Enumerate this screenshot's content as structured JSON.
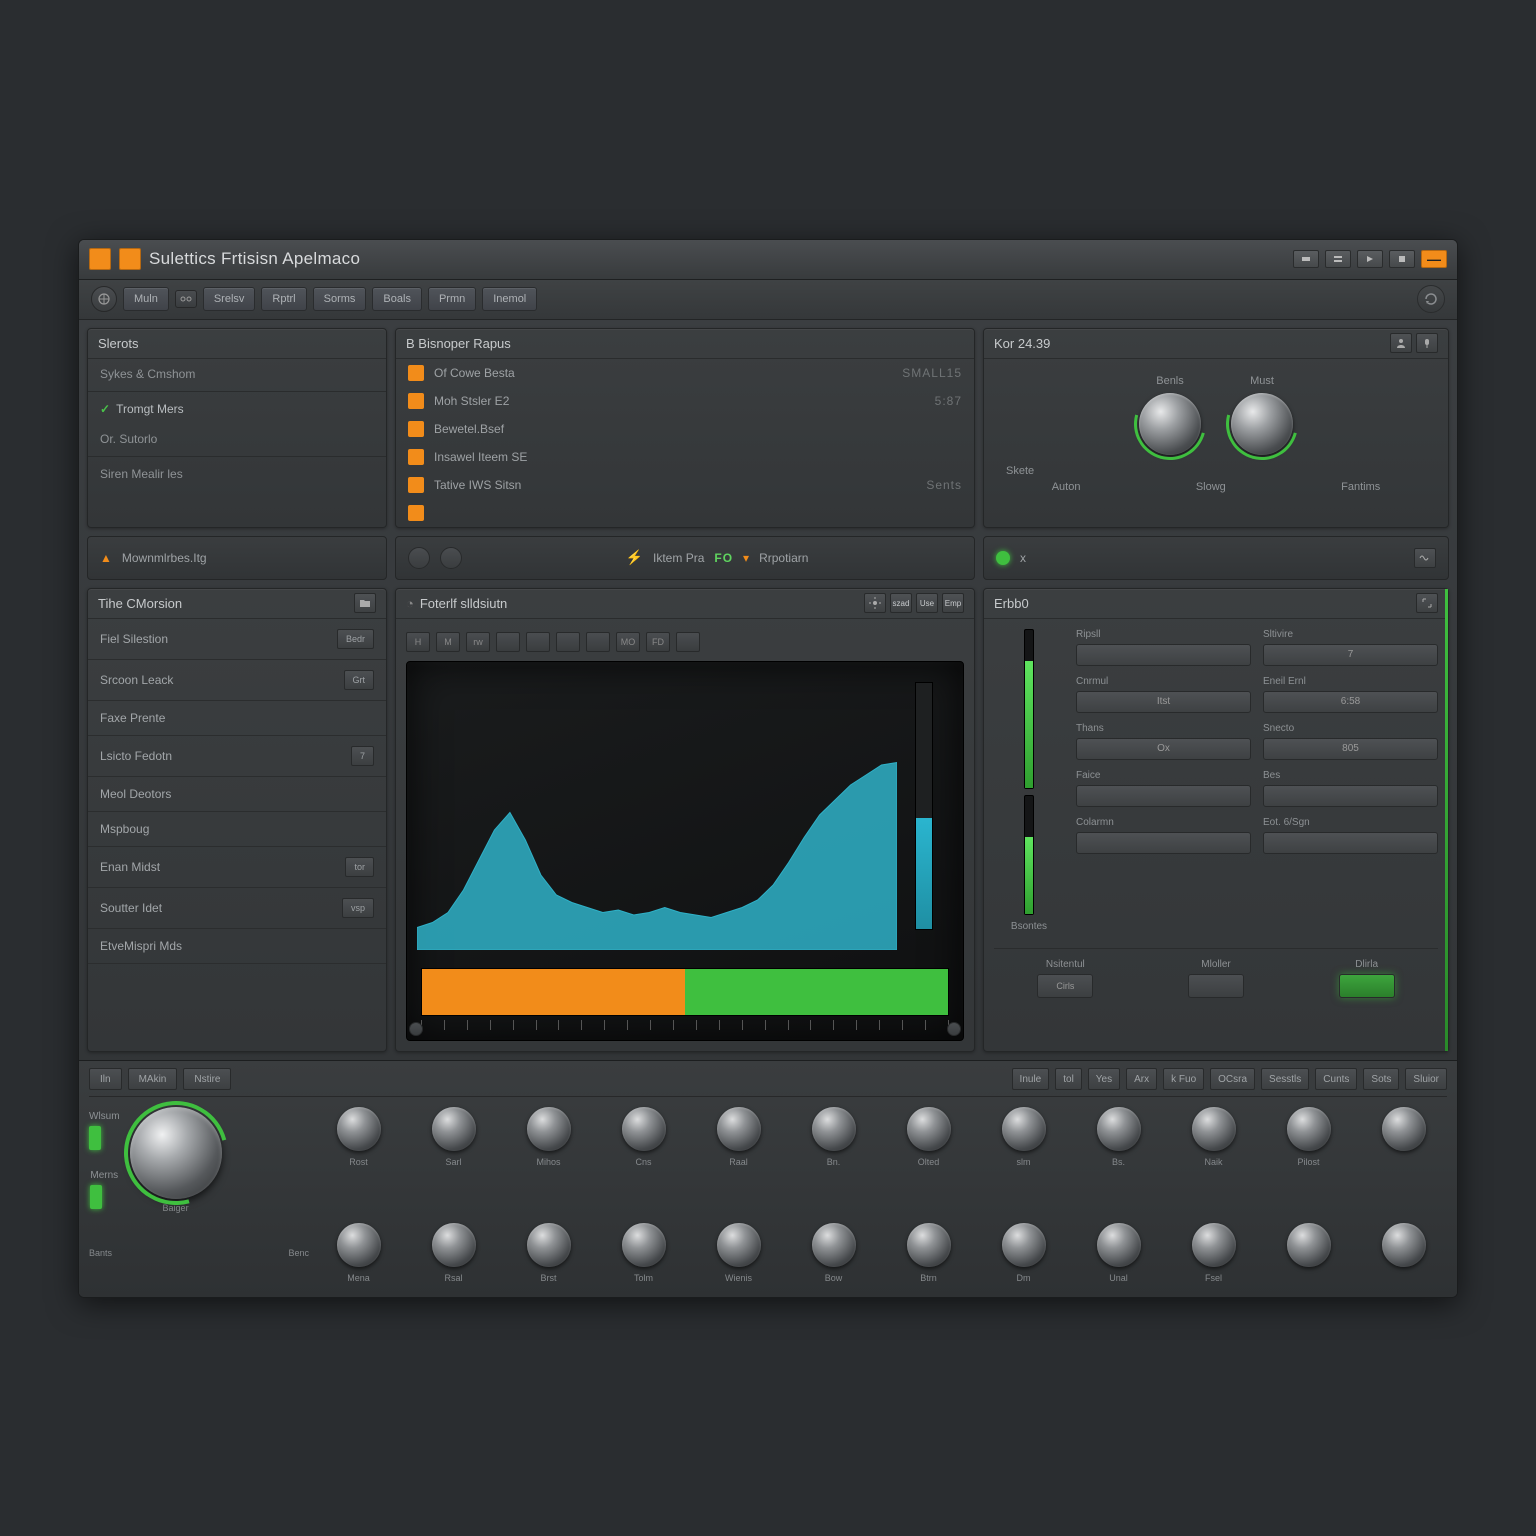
{
  "colors": {
    "accent_orange": "#f28c1a",
    "accent_green": "#3fbf3f",
    "wave_teal": "#2fb1c8"
  },
  "title": "Sulettics Frtisisn Apelmaco",
  "toolbar": {
    "buttons": [
      "Muln",
      "Srelsv",
      "Rptrl",
      "Sorms",
      "Boals",
      "Prmn",
      "Inemol"
    ]
  },
  "sidebar": {
    "title": "Slerots",
    "items": [
      {
        "label": "Sykes & Cmshom",
        "checked": false
      },
      {
        "label": "Tromgt Mers",
        "checked": true
      },
      {
        "label": "Or. Sutorlo",
        "checked": false
      }
    ],
    "footer": "Siren Mealir les"
  },
  "records": {
    "title": "B Bisnoper Rapus",
    "rows": [
      {
        "label": "Of Cowe Besta",
        "value": "SMALL15"
      },
      {
        "label": "Moh Stsler E2",
        "value": "5:87"
      },
      {
        "label": "Bewetel.Bsef",
        "value": ""
      },
      {
        "label": "Insawel Iteem SE",
        "value": ""
      },
      {
        "label": "Tative IWS Sitsn",
        "value": "Sents"
      },
      {
        "label": "",
        "value": ""
      }
    ]
  },
  "knob_panel": {
    "title": "Kor 24.39",
    "knobs": [
      {
        "top": "Benls",
        "bottom": "Skete"
      },
      {
        "top": "Must",
        "bottom": ""
      }
    ],
    "extras": [
      "Auton",
      "Slowg",
      "Fantims"
    ]
  },
  "status": {
    "left": {
      "label": "Mownmlrbes.Itg"
    },
    "mid": {
      "label1": "Iktem Pra",
      "fo": "FO",
      "label2": "Rrpotiarn"
    },
    "right": {
      "x": "x"
    }
  },
  "modules": {
    "title": "Tihe CMorsion",
    "rows": [
      {
        "label": "Fiel Silestion",
        "btn": "Bedr"
      },
      {
        "label": "Srcoon Leack",
        "btn": "Grt"
      },
      {
        "label": "Faxe Prente",
        "btn": ""
      },
      {
        "label": "Lsicto Fedotn",
        "btn": "7"
      },
      {
        "label": "Meol Deotors",
        "btn": ""
      },
      {
        "label": "Mspboug",
        "btn": ""
      },
      {
        "label": "Enan Midst",
        "btn": "tor"
      },
      {
        "label": "Soutter Idet",
        "btn": "vsp"
      },
      {
        "label": "EtveMispri Mds",
        "btn": ""
      }
    ]
  },
  "visualizer": {
    "title": "Foterlf slldsiutn",
    "top_icons": [
      "H",
      "M",
      "rw",
      "",
      "",
      "",
      "",
      "MO",
      "FD",
      ""
    ],
    "side_btns": [
      "szad",
      "Use",
      "Emp"
    ]
  },
  "fx": {
    "title": "Erbb0",
    "rows": [
      {
        "l1": "Ripsll",
        "l2": "Sltivire",
        "b1": "",
        "b2": "7"
      },
      {
        "l1": "Cnrmul",
        "l2": "Eneil Ernl",
        "b1": "Itst",
        "b2": "6:58"
      },
      {
        "l1": "Thans",
        "l2": "Snecto",
        "b1": "Ox",
        "b2": "805"
      },
      {
        "l1": "Faice",
        "l2": "Bes",
        "b1": "",
        "b2": ""
      },
      {
        "l1": "Colarmn",
        "l2": "Eot. 6/Sgn",
        "b1": "",
        "b2": ""
      }
    ],
    "meter_lbl": "Bsontes",
    "meter_fill": 65,
    "bottom": [
      {
        "label": "Nsitentul",
        "btn": "Cirls",
        "on": false
      },
      {
        "label": "Mloller",
        "btn": "",
        "on": false
      },
      {
        "label": "Dlirla",
        "btn": "",
        "on": true
      }
    ]
  },
  "mixer": {
    "tabs_left": [
      "Iln",
      "MAkin",
      "Nstire"
    ],
    "tabs_right": [
      "Inule",
      "tol",
      "Yes",
      "Arx",
      "k Fuo",
      "OCsra",
      "Sesstls",
      "Cunts",
      "Sots",
      "Sluior"
    ],
    "master": {
      "top": "Wlsum",
      "bottom": "Merns",
      "knob_label": "Baiger"
    },
    "channels_top": [
      "Rost",
      "Sarl",
      "Mihos",
      "Cns",
      "Raal",
      "Bn.",
      "Olted",
      "slm",
      "Bs.",
      "Naik",
      "Pilost"
    ],
    "channels_bot": [
      "Bants",
      "Benc",
      "Mena",
      "Rsal",
      "Brst",
      "Tolm",
      "Wienis",
      "Bow",
      "Btrn",
      "Dm",
      "Unal",
      "Fsel"
    ]
  },
  "chart_data": {
    "type": "area",
    "title": "Foterlf slldsiutn",
    "xlabel": "",
    "ylabel": "",
    "x": [
      0,
      1,
      2,
      3,
      4,
      5,
      6,
      7,
      8,
      9,
      10,
      11,
      12,
      13,
      14,
      15,
      16,
      17,
      18,
      19,
      20,
      21,
      22,
      23,
      24,
      25,
      26,
      27,
      28,
      29,
      30,
      31
    ],
    "values": [
      18,
      22,
      30,
      48,
      72,
      96,
      110,
      88,
      60,
      44,
      38,
      34,
      30,
      32,
      28,
      30,
      34,
      30,
      28,
      26,
      30,
      34,
      40,
      52,
      70,
      90,
      108,
      120,
      132,
      140,
      148,
      150
    ],
    "ylim": [
      0,
      160
    ],
    "level_meter_pct": 45,
    "progress": {
      "orange_pct": 50,
      "green_pct": 50
    }
  }
}
